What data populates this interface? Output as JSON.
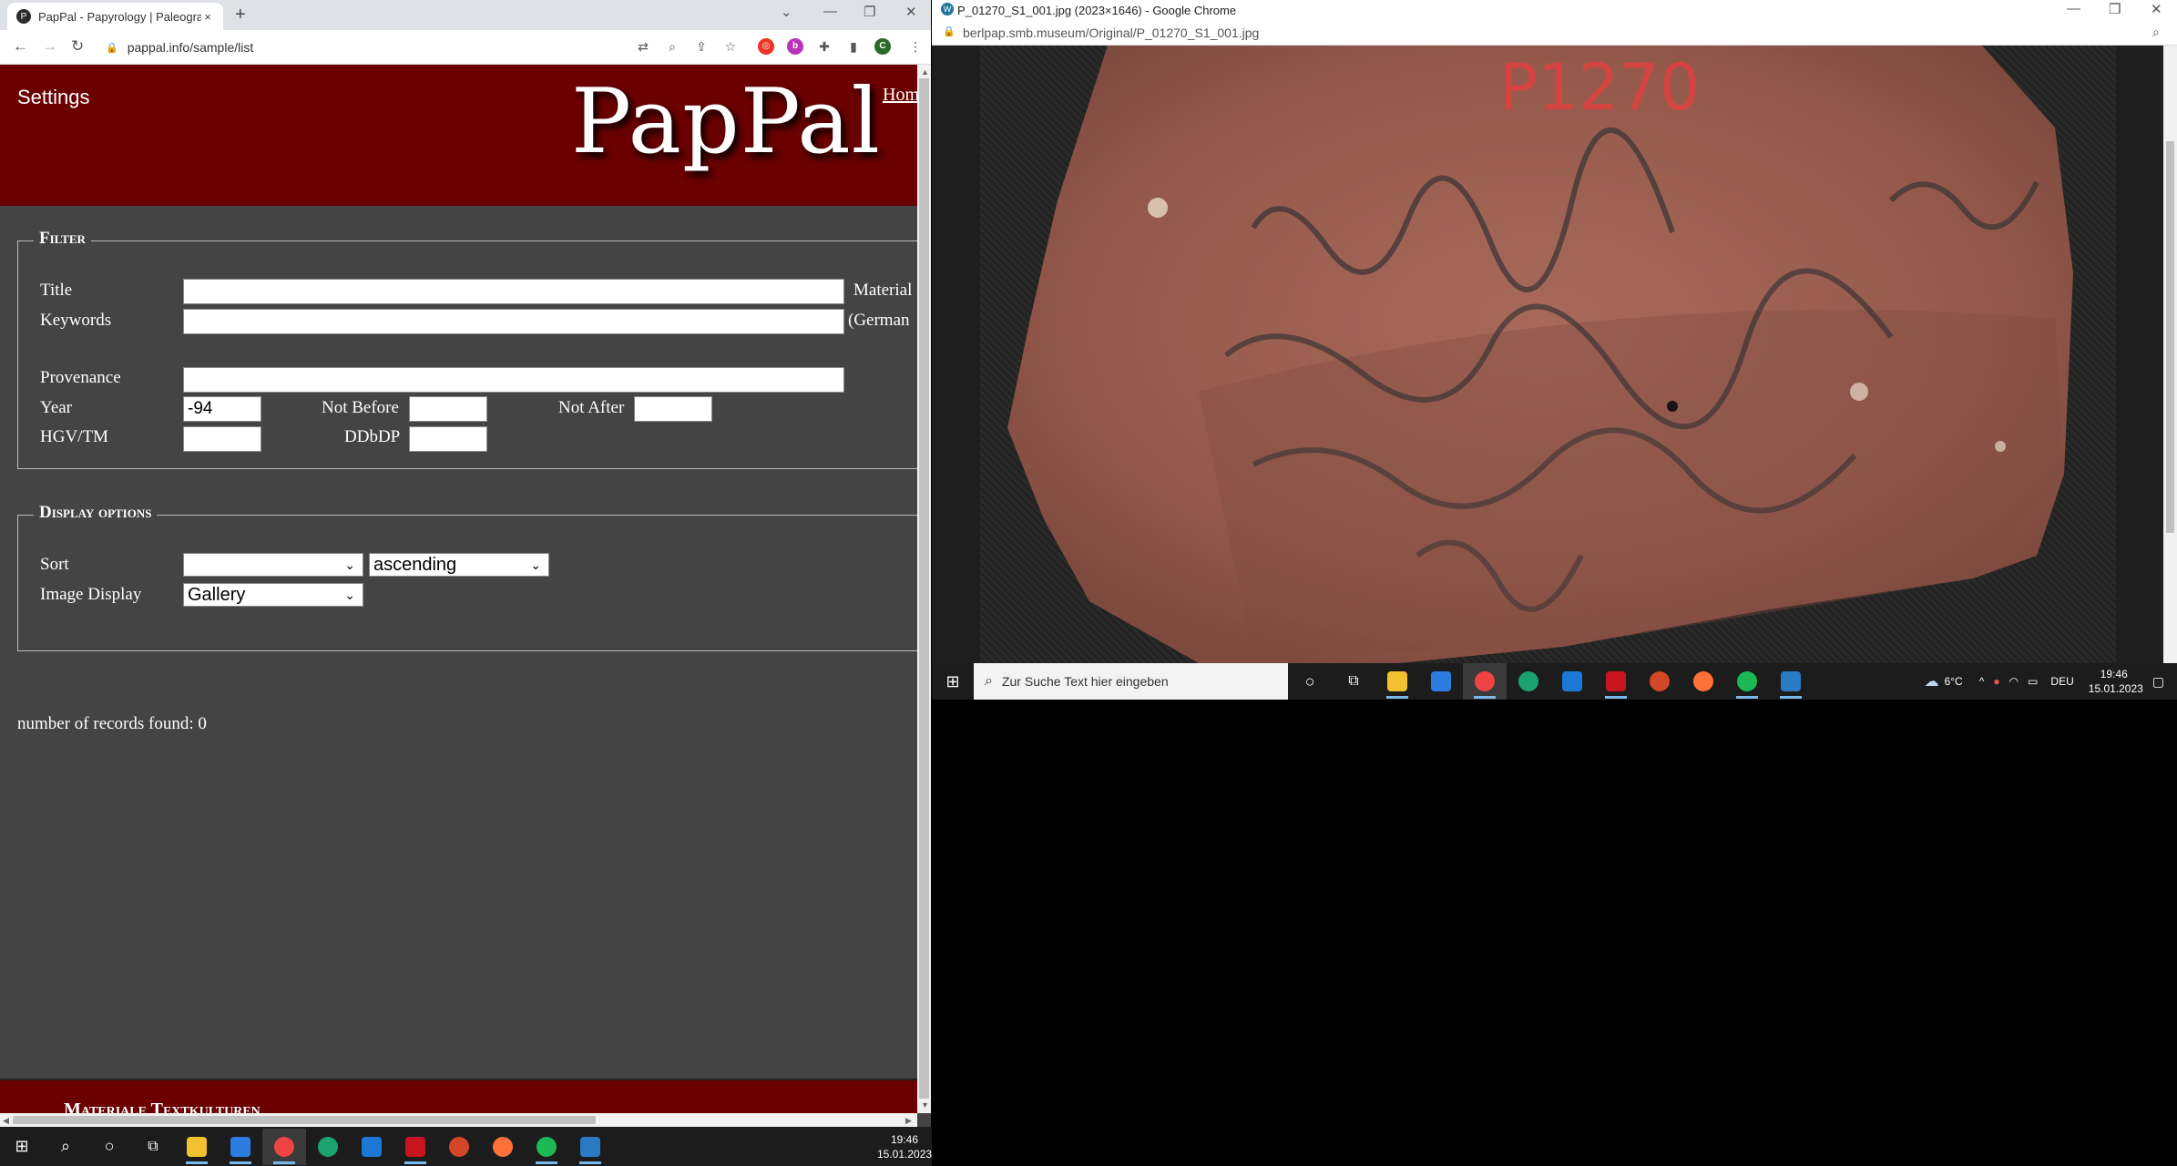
{
  "left_browser": {
    "tab_title": "PapPal - Papyrology | Paleograph",
    "tab_favicon": "P",
    "tab_close": "×",
    "new_tab": "+",
    "url": "pappal.info/sample/list",
    "window_controls": [
      "⌄",
      "—",
      "❐",
      "✕"
    ]
  },
  "site": {
    "settings_label": "Settings",
    "logo": "PapPal",
    "home_link": "Hom",
    "filter": {
      "legend": "Filter",
      "title_label": "Title",
      "title_value": "",
      "material_label": "Material",
      "keywords_label": "Keywords",
      "keywords_value": "",
      "keywords_suffix": "(German",
      "provenance_label": "Provenance",
      "provenance_value": "",
      "year_label": "Year",
      "year_value": "-94",
      "not_before_label": "Not Before",
      "not_before_value": "",
      "not_after_label": "Not After",
      "not_after_value": "",
      "hgv_label": "HGV/TM",
      "hgv_value": "",
      "ddbdp_label": "DDbDP",
      "ddbdp_value": ""
    },
    "display": {
      "legend": "Display options",
      "sort_label": "Sort",
      "sort_field_value": "",
      "sort_order_value": "ascending",
      "image_display_label": "Image Display",
      "image_display_value": "Gallery"
    },
    "records_text": "number of records found: 0",
    "footer_text": "Materiale Textkulturen"
  },
  "left_taskbar": {
    "clock_time": "19:46",
    "clock_date": "15.01.2023"
  },
  "right_browser": {
    "title": "P_01270_S1_001.jpg (2023×1646) - Google Chrome",
    "url": "berlpap.smb.museum/Original/P_01270_S1_001.jpg",
    "image_description_icon": "papyrus-ostracon-image"
  },
  "right_taskbar": {
    "search_placeholder": "Zur Suche Text hier eingeben",
    "weather": "6°C",
    "language": "DEU",
    "clock_time": "19:46",
    "clock_date": "15.01.2023"
  },
  "colors": {
    "site_red": "#6b0000",
    "content_bg": "#444444",
    "taskbar": "#1c1c1c"
  }
}
